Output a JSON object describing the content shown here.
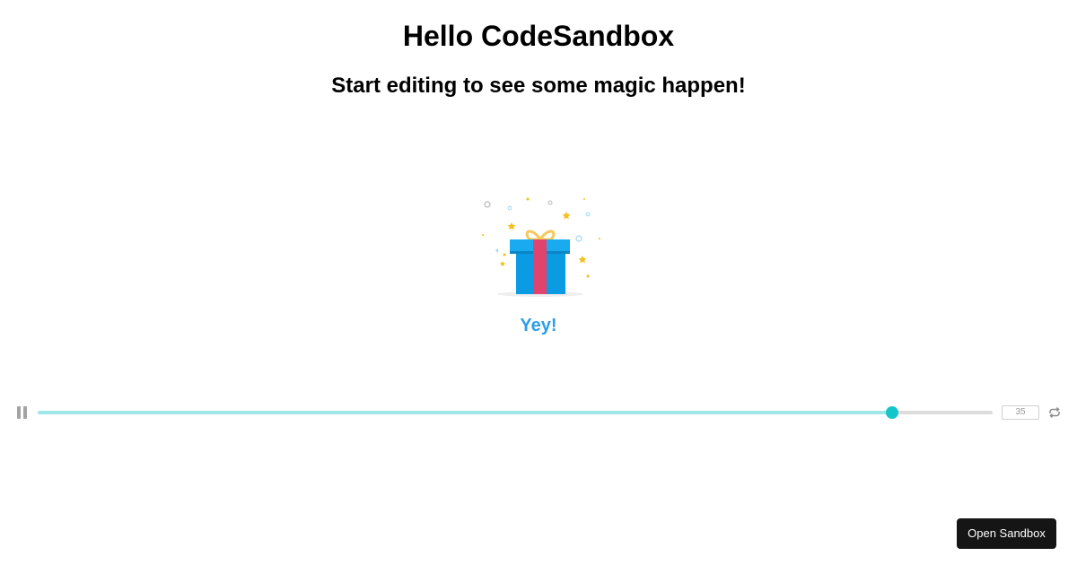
{
  "header": {
    "title": "Hello CodeSandbox",
    "subtitle": "Start editing to see some magic happen!"
  },
  "animation": {
    "caption": "Yey!",
    "icon": "gift-box-icon",
    "colors": {
      "box": "#0b9be3",
      "box_lid": "#1aaaf0",
      "ribbon": "#e0436e",
      "bow": "#f4c95a",
      "caption": "#2e9ee8",
      "confetti_gold": "#f6be1a",
      "confetti_blue": "#9dd9f3"
    }
  },
  "player": {
    "pause_icon": "pause-icon",
    "loop_icon": "loop-icon",
    "progress": 0.895,
    "frame_value": "35",
    "colors": {
      "track": "#dcdcdc",
      "fill": "#9ee8ea",
      "thumb": "#14c6c9"
    }
  },
  "footer": {
    "open_sandbox_label": "Open Sandbox"
  }
}
